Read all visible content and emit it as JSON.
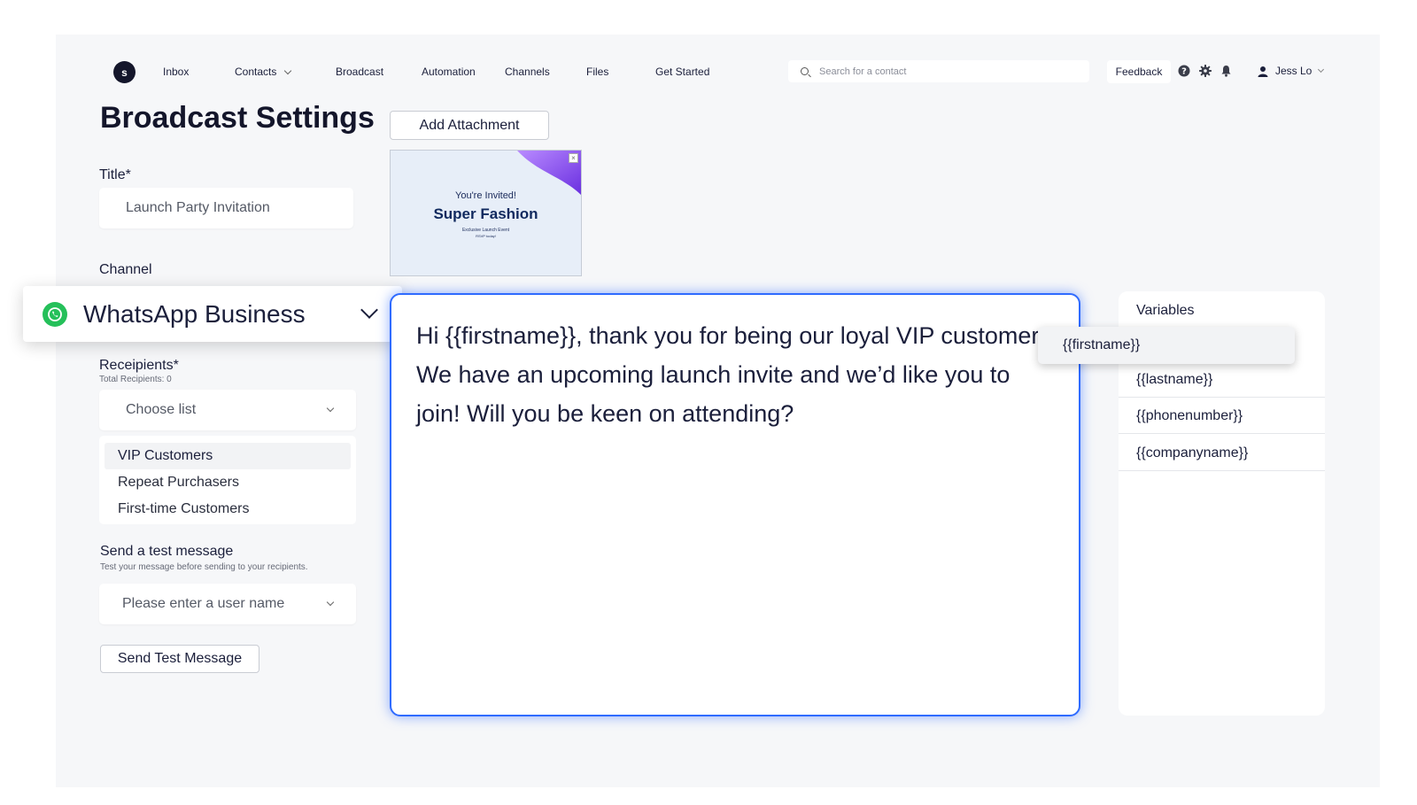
{
  "nav": {
    "logo_letter": "s",
    "items": [
      "Inbox",
      "Contacts",
      "Broadcast",
      "Automation",
      "Channels",
      "Files",
      "Get Started"
    ],
    "search_placeholder": "Search for a contact",
    "feedback_label": "Feedback",
    "user_name": "Jess Lo"
  },
  "page": {
    "title": "Broadcast Settings"
  },
  "form": {
    "title_label": "Title*",
    "title_value": "Launch Party Invitation",
    "channel_label": "Channel",
    "channel_value": "WhatsApp Business",
    "recipients_label": "Receipients*",
    "recipients_total": "Total Recipients: 0",
    "choose_list_placeholder": "Choose list",
    "list_options": [
      "VIP Customers",
      "Repeat Purchasers",
      "First-time Customers"
    ],
    "test_label": "Send a test message",
    "test_hint": "Test your message before sending to your recipients.",
    "user_placeholder": "Please enter a user name",
    "send_test_label": "Send Test Message"
  },
  "attachment": {
    "button_label": "Add Attachment",
    "close_glyph": "×",
    "invited": "You're Invited!",
    "title": "Super Fashion",
    "subtitle": "Exclusive Launch Event",
    "subtitle2": "RSVP today!"
  },
  "editor": {
    "message": "Hi {{firstname}}, thank you for being our loyal VIP customer! We have an upcoming launch invite and we’d like you to join! Will you be keen on attending?"
  },
  "variables": {
    "title": "Variables",
    "dragged": "{{firstname}}",
    "items": [
      "{{lastname}}",
      "{{phonenumber}}",
      "{{companyname}}"
    ]
  },
  "colors": {
    "accent": "#2f6bff",
    "whatsapp": "#25c05a",
    "background": "#f6f7f9"
  }
}
